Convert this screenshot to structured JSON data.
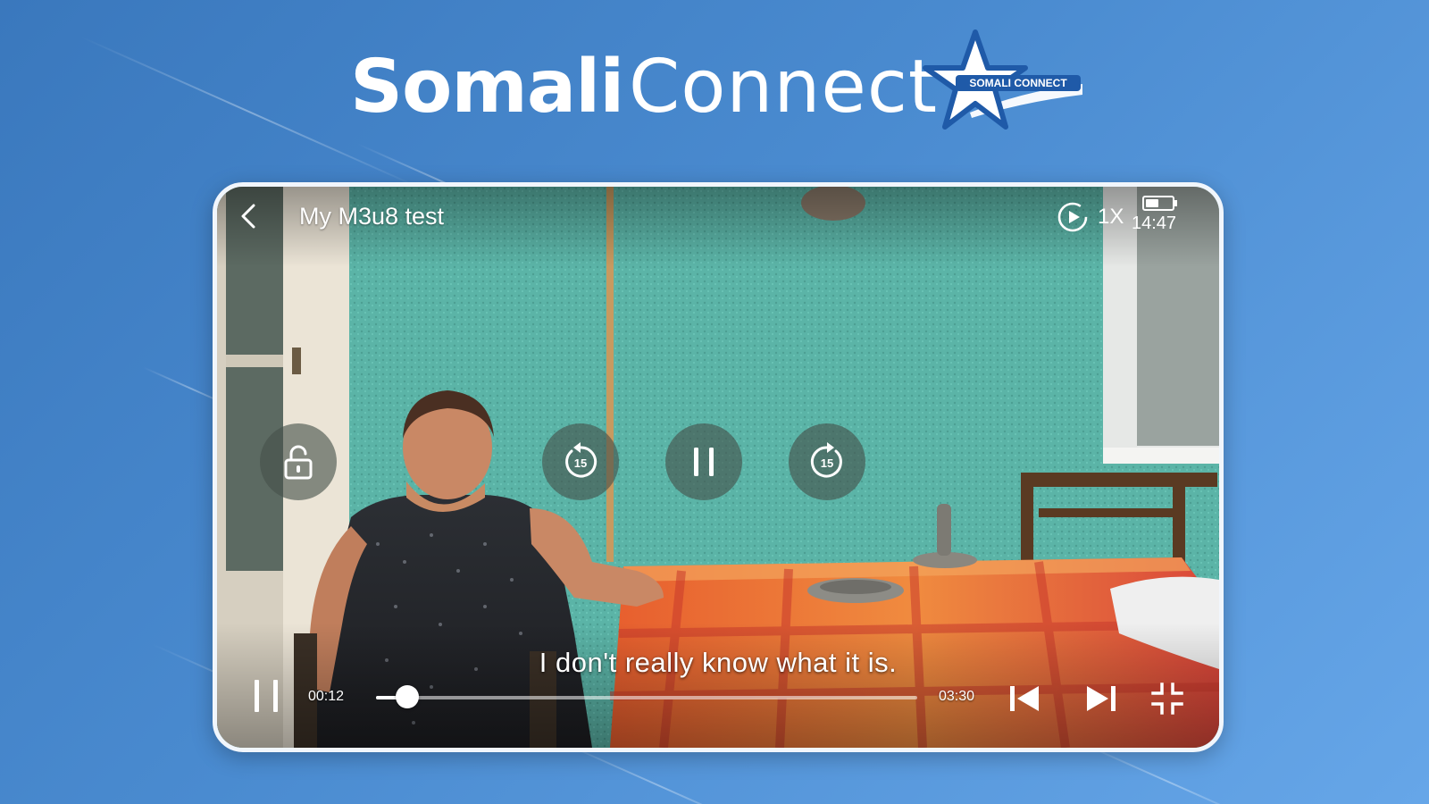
{
  "brand": {
    "name_part1": "Somali",
    "name_part2": "Connect",
    "logo_icon": "star-logo-icon",
    "logo_text": "SOMALI CONNECT"
  },
  "player": {
    "title": "My M3u8 test",
    "speed_label": "1X",
    "clock": "14:47",
    "battery_level": 0.55,
    "subtitle": "I don't really know what it is.",
    "current_time": "00:12",
    "total_time": "03:30",
    "progress": 0.057,
    "rewind_seconds": "15",
    "forward_seconds": "15",
    "icons": {
      "back": "chevron-left-icon",
      "speed": "play-circle-icon",
      "lock": "unlock-icon",
      "rewind": "rewind-15-icon",
      "pause": "pause-icon",
      "forward": "forward-15-icon",
      "previous": "skip-previous-icon",
      "next": "skip-next-icon",
      "exit_fullscreen": "fullscreen-exit-icon"
    }
  },
  "colors": {
    "background_start": "#3a78bd",
    "background_end": "#66a6e8",
    "frame": "#f1f6fc",
    "wall": "#5fb8ad",
    "tablecloth": "#e8733a",
    "control_bg": "rgba(70,80,75,0.62)"
  }
}
